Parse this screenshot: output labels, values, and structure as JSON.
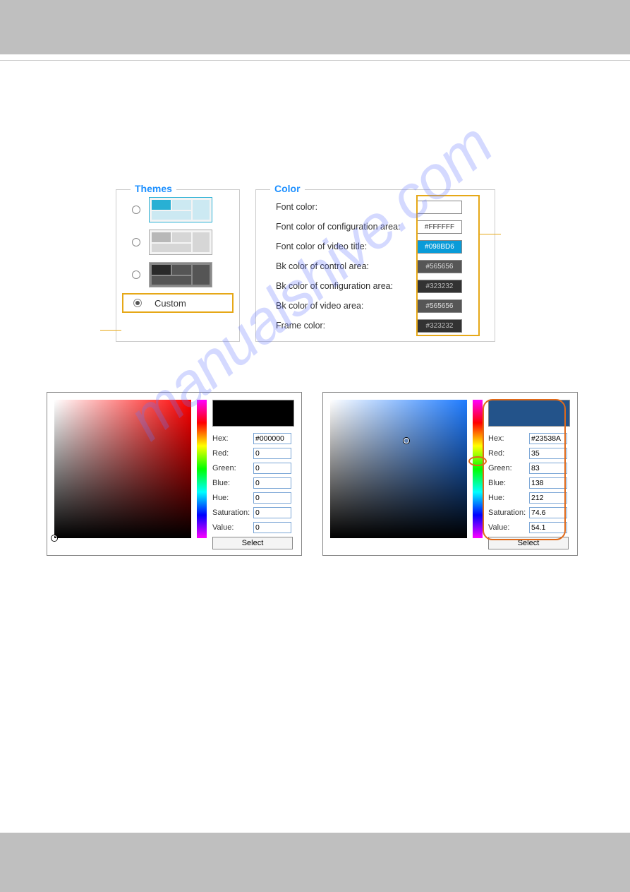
{
  "themes": {
    "legend": "Themes",
    "custom_label": "Custom"
  },
  "color": {
    "legend": "Color",
    "rows": [
      {
        "label": "Font color:",
        "value": ""
      },
      {
        "label": "Font color of configuration area:",
        "value": "#FFFFFF"
      },
      {
        "label": "Font color of video title:",
        "value": "#098BD6"
      },
      {
        "label": "Bk color of control area:",
        "value": "#565656"
      },
      {
        "label": "Bk color of configuration area:",
        "value": "#323232"
      },
      {
        "label": "Bk color of video area:",
        "value": "#565656"
      },
      {
        "label": "Frame color:",
        "value": "#323232"
      }
    ]
  },
  "picker": {
    "labels": {
      "hex": "Hex:",
      "red": "Red:",
      "green": "Green:",
      "blue": "Blue:",
      "hue": "Hue:",
      "saturation": "Saturation:",
      "value": "Value:",
      "select": "Select"
    },
    "left": {
      "hex": "#000000",
      "red": "0",
      "green": "0",
      "blue": "0",
      "hue": "0",
      "saturation": "0",
      "value": "0"
    },
    "right": {
      "hex": "#23538A",
      "red": "35",
      "green": "83",
      "blue": "138",
      "hue": "212",
      "saturation": "74.6",
      "value": "54.1"
    }
  },
  "watermark": "manualshive.com"
}
